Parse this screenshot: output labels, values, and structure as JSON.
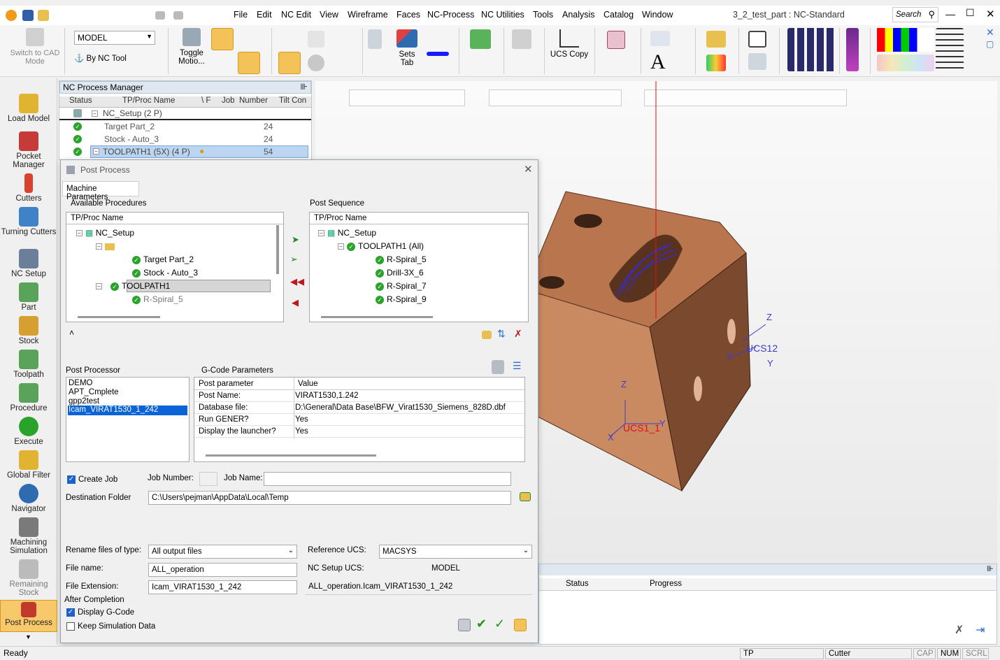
{
  "window": {
    "title": "3_2_test_part : NC-Standard",
    "search_placeholder": "Search"
  },
  "menu": [
    "File",
    "Edit",
    "NC Edit",
    "View",
    "Wireframe",
    "Faces",
    "NC-Process",
    "NC Utilities",
    "Tools",
    "Analysis",
    "Catalog",
    "Window"
  ],
  "toolbar": {
    "switch_cad": "Switch to CAD Mode",
    "model_select": "MODEL",
    "by_nc_tool": "By NC Tool",
    "toggle_motion": "Toggle Motio...",
    "sets_tab": "Sets Tab",
    "ucs_copy": "UCS Copy"
  },
  "sidebar": [
    {
      "label": "Load Model",
      "icon": "load-model-icon",
      "color": "#e0b430"
    },
    {
      "label": "Pocket Manager",
      "icon": "pocket-manager-icon",
      "color": "#c73a3a"
    },
    {
      "label": "Cutters",
      "icon": "cutters-icon",
      "color": "#d9422e"
    },
    {
      "label": "Turning Cutters",
      "icon": "turning-cutters-icon",
      "color": "#3f82c7"
    },
    {
      "label": "NC Setup",
      "icon": "nc-setup-icon",
      "color": "#6b7f9a"
    },
    {
      "label": "Part",
      "icon": "part-icon",
      "color": "#5aa35a"
    },
    {
      "label": "Stock",
      "icon": "stock-icon",
      "color": "#d6a030"
    },
    {
      "label": "Toolpath",
      "icon": "toolpath-icon",
      "color": "#5aa35a"
    },
    {
      "label": "Procedure",
      "icon": "procedure-icon",
      "color": "#5aa35a"
    },
    {
      "label": "Execute",
      "icon": "execute-icon",
      "color": "#2aa32a"
    },
    {
      "label": "Global Filter",
      "icon": "global-filter-icon",
      "color": "#e0b430"
    },
    {
      "label": "Navigator",
      "icon": "navigator-icon",
      "color": "#2f6bb0"
    },
    {
      "label": "Machining Simulation",
      "icon": "machining-simulation-icon",
      "color": "#7a7a7a"
    },
    {
      "label": "Remaining Stock",
      "icon": "remaining-stock-icon",
      "color": "#bbbbbb"
    },
    {
      "label": "Post Process",
      "icon": "post-process-icon",
      "color": "#c0392b"
    }
  ],
  "nc_manager": {
    "title": "NC Process Manager",
    "columns": [
      "Status",
      "TP/Proc Name",
      "\\ F",
      "Job",
      "Number",
      "Tilt Con"
    ],
    "rows": [
      {
        "name": "NC_Setup (2 P)",
        "number": ""
      },
      {
        "name": "Target Part_2",
        "number": "24"
      },
      {
        "name": "Stock - Auto_3",
        "number": "24"
      },
      {
        "name": "TOOLPATH1 (5X) (4 P)",
        "number": "54"
      }
    ]
  },
  "dialog": {
    "title": "Post Process",
    "tab": "Machine Parameters",
    "available_label": "Available Procedures",
    "sequence_label": "Post Sequence",
    "tree_header": "TP/Proc Name",
    "available_tree": [
      {
        "label": "NC_Setup"
      },
      {
        "label": ""
      },
      {
        "label": "Target Part_2"
      },
      {
        "label": "Stock - Auto_3"
      },
      {
        "label": "TOOLPATH1"
      },
      {
        "label": "R-Spiral_5"
      }
    ],
    "sequence_tree": [
      {
        "label": "NC_Setup"
      },
      {
        "label": "TOOLPATH1 (All)"
      },
      {
        "label": "R-Spiral_5"
      },
      {
        "label": "Drill-3X_6"
      },
      {
        "label": "R-Spiral_7"
      },
      {
        "label": "R-Spiral_9"
      }
    ],
    "post_processor_label": "Post Processor",
    "post_processors": [
      "DEMO",
      "APT_Cmplete",
      "gpp2test",
      "Icam_VIRAT1530_1_242"
    ],
    "gcode_label": "G-Code Parameters",
    "gcode_columns": [
      "Post parameter",
      "Value"
    ],
    "gcode_rows": [
      {
        "param": "Post Name:",
        "value": "VIRAT1530,1.242"
      },
      {
        "param": "Database file:",
        "value": "D:\\General\\Data Base\\BFW_Virat1530_Siemens_828D.dbf"
      },
      {
        "param": "Run GENER?",
        "value": "Yes"
      },
      {
        "param": "Display the launcher?",
        "value": "Yes"
      }
    ],
    "create_job": "Create Job",
    "job_number_label": "Job Number:",
    "job_name_label": "Job Name:",
    "destination_label": "Destination Folder",
    "destination_value": "C:\\Users\\pejman\\AppData\\Local\\Temp",
    "rename_label": "Rename files of type:",
    "rename_value": "All output files",
    "ref_ucs_label": "Reference UCS:",
    "ref_ucs_value": "MACSYS",
    "file_name_label": "File name:",
    "file_name_value": "ALL_operation",
    "nc_setup_ucs_label": "NC Setup UCS:",
    "nc_setup_ucs_value": "MODEL",
    "file_ext_label": "File Extension:",
    "file_ext_value": "Icam_VIRAT1530_1_242",
    "output_preview": "ALL_operation.Icam_VIRAT1530_1_242",
    "after_completion": "After Completion",
    "display_gcode": "Display G-Code",
    "keep_sim": "Keep Simulation Data"
  },
  "viewport": {
    "ucs_a": "UCS12",
    "ucs_b": "UCS1_1",
    "axis_x": "X",
    "axis_y": "Y",
    "axis_z": "Z"
  },
  "bottom_panel": {
    "status_col": "Status",
    "progress_col": "Progress"
  },
  "statusbar": {
    "ready": "Ready",
    "tp": "TP",
    "cutter": "Cutter",
    "cap": "CAP",
    "num": "NUM",
    "scrl": "SCRL"
  }
}
